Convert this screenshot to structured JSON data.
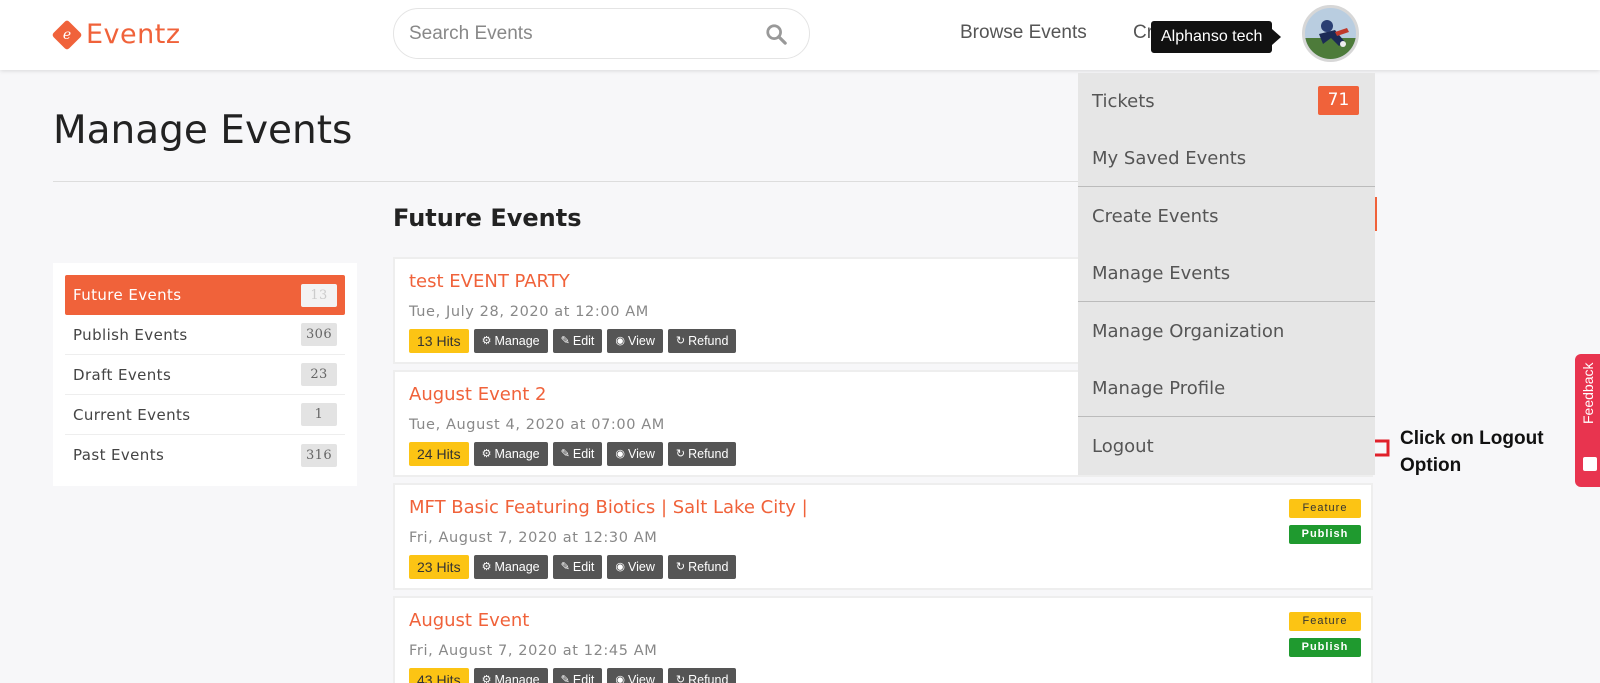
{
  "header": {
    "logo_text": "Eventz",
    "logo_letter": "e",
    "search_placeholder": "Search Events",
    "nav": {
      "browse": "Browse Events",
      "create_partial": "Cr"
    },
    "tooltip": "Alphanso tech"
  },
  "main": {
    "page_title": "Manage Events",
    "section_title": "Future Events"
  },
  "sidebar": {
    "items": [
      {
        "label": "Future Events",
        "count": "13"
      },
      {
        "label": "Publish Events",
        "count": "306"
      },
      {
        "label": "Draft Events",
        "count": "23"
      },
      {
        "label": "Current Events",
        "count": "1"
      },
      {
        "label": "Past Events",
        "count": "316"
      }
    ]
  },
  "events": [
    {
      "title": "test EVENT PARTY",
      "date": "Tue, July 28, 2020 at 12:00 AM",
      "hits": "13 Hits"
    },
    {
      "title": "August Event 2",
      "date": "Tue, August 4, 2020 at 07:00 AM",
      "hits": "24 Hits"
    },
    {
      "title": "MFT Basic Featuring Biotics | Salt Lake City |",
      "date": "Fri, August 7, 2020 at 12:30 AM",
      "hits": "23 Hits",
      "feature": "Feature",
      "publish": "Publish"
    },
    {
      "title": "August Event",
      "date": "Fri, August 7, 2020 at 12:45 AM",
      "hits": "43 Hits",
      "feature": "Feature",
      "publish": "Publish"
    }
  ],
  "actions": {
    "manage": "Manage",
    "edit": "Edit",
    "view": "View",
    "refund": "Refund"
  },
  "dropdown": {
    "tickets": "Tickets",
    "tickets_count": "71",
    "saved": "My Saved Events",
    "create": "Create Events",
    "manage": "Manage Events",
    "organization": "Manage Organization",
    "profile": "Manage Profile",
    "logout": "Logout"
  },
  "annotation": {
    "line1": "Click on Logout",
    "line2": "Option"
  },
  "feedback": "Feedback",
  "colors": {
    "brand": "#f0623a",
    "hits": "#fcc414",
    "publish": "#1f9a2f",
    "feedback": "#e8344f"
  }
}
